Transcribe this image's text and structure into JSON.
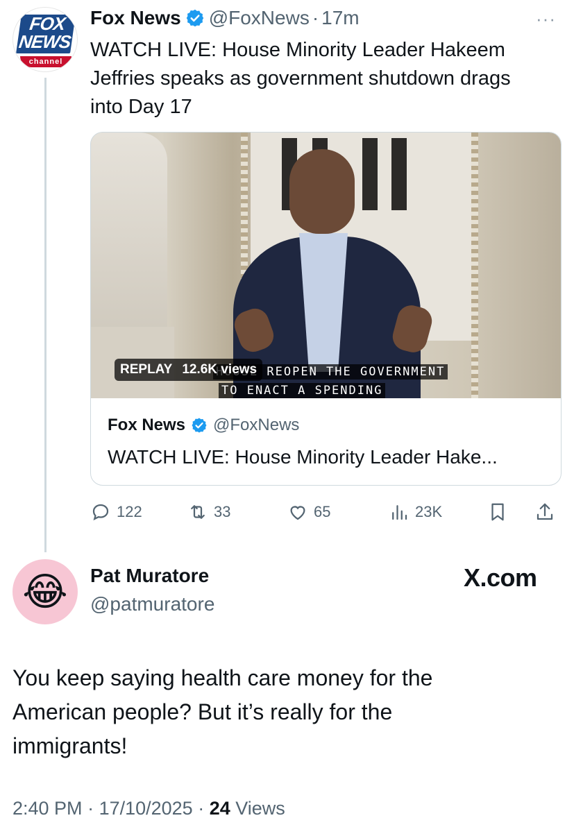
{
  "tweet": {
    "author_name": "Fox News",
    "handle": "@FoxNews",
    "separator": "·",
    "time_ago": "17m",
    "more_icon": "···",
    "avatar": {
      "logo_top": "FOX",
      "logo_bottom": "NEWS",
      "logo_channel": "channel"
    },
    "text_line1": "WATCH LIVE: House Minority Leader Hakeem",
    "text_line2": "Jeffries speaks as government shutdown drags",
    "text_line3": "into Day 17",
    "media": {
      "replay_label": "REPLAY",
      "views_label": "12.6K views",
      "caption_line1": "HOUSE REOPEN THE GOVERNMENT",
      "caption_line2": "TO ENACT A SPENDING",
      "card_author": "Fox News",
      "card_handle": "@FoxNews",
      "card_text": "WATCH LIVE: House Minority Leader Hake..."
    },
    "actions": {
      "replies": "122",
      "reposts": "33",
      "likes": "65",
      "views": "23K"
    }
  },
  "reply": {
    "author_name": "Pat Muratore",
    "handle": "@patmuratore",
    "avatar_emoji": "😂",
    "watermark": "X.com",
    "text_line1": "You keep saying health care money for the",
    "text_line2": "American people? But it’s really for the",
    "text_line3": "immigrants!",
    "time": "2:40 PM",
    "sep": " · ",
    "date": "17/10/2025",
    "views_count": "24",
    "views_label": " Views"
  },
  "colors": {
    "verified_blue": "#1d9bf0",
    "muted": "#536471",
    "fox_blue": "#1c4a8a",
    "fox_red": "#c8102e"
  }
}
